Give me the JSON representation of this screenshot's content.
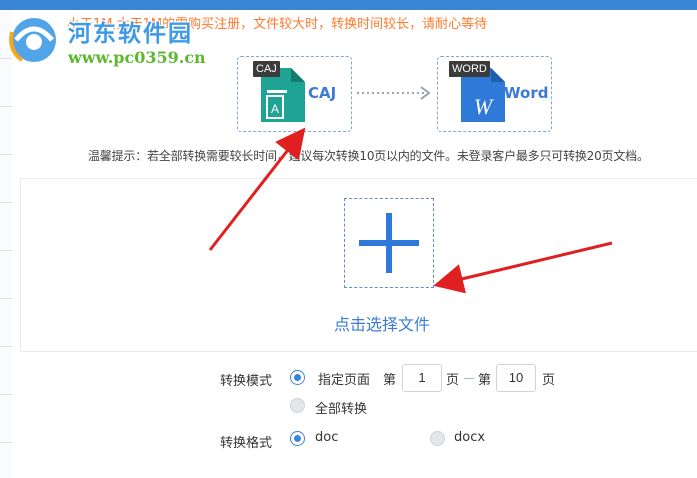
{
  "notice": "小于1M,大于1M的需购买注册，文件较大时，转换时间较长，请耐心等待",
  "watermark": {
    "title": "河东软件园",
    "url": "www.pc0359.cn"
  },
  "formats": {
    "source": {
      "badge": "CAJ",
      "label": "CAJ",
      "glyph": "A",
      "color": "#1fa394",
      "icon": "caj-document-icon"
    },
    "target": {
      "badge": "WORD",
      "label": "Word",
      "glyph": "W",
      "color": "#2f7ad8",
      "icon": "word-document-icon"
    },
    "arrow_icon": "dotted-arrow-right-icon"
  },
  "tip": "温馨提示：若全部转换需要较长时间，建议每次转换10页以内的文件。未登录客户最多只可转换20页文档。",
  "upload": {
    "icon": "plus-icon",
    "label": "点击选择文件"
  },
  "mode": {
    "label": "转换模式",
    "options": [
      {
        "label": "指定页面",
        "checked": true
      },
      {
        "label": "全部转换",
        "checked": false
      }
    ],
    "page_prefix": "第",
    "page_suffix": "页",
    "page_from": "1",
    "page_to": "10"
  },
  "format": {
    "label": "转换格式",
    "options": [
      {
        "label": "doc",
        "checked": true
      },
      {
        "label": "docx",
        "checked": false
      }
    ]
  },
  "colors": {
    "accent": "#3a86d6",
    "notice": "#ff7a2f",
    "annotation_arrow": "#e02020"
  }
}
